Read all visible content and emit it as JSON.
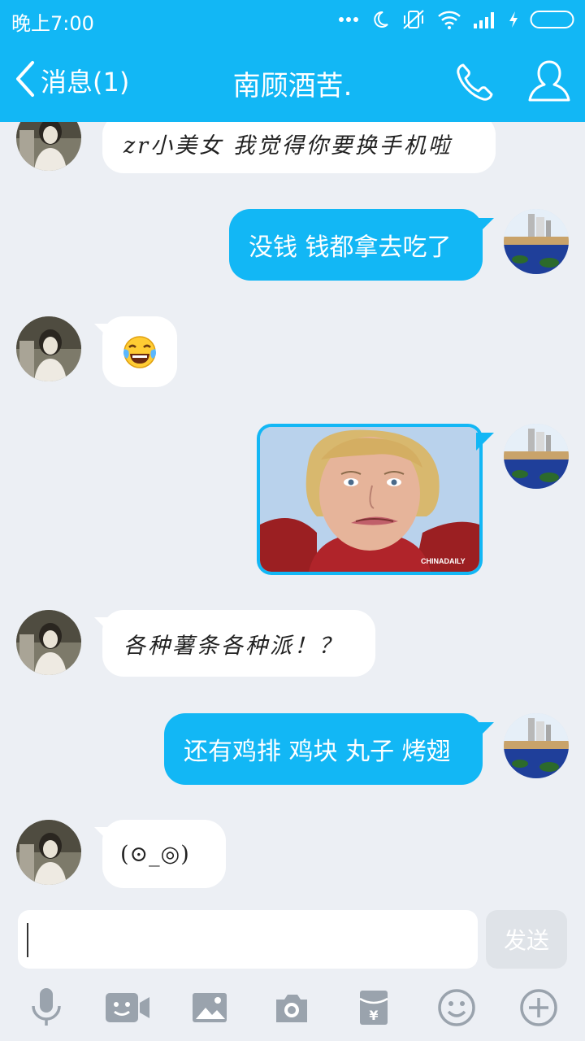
{
  "status_bar": {
    "time": "晚上7:00",
    "icons": [
      "more-dots-icon",
      "moon-icon",
      "vibrate-off-icon",
      "wifi-icon",
      "signal-icon",
      "charging-icon",
      "battery-icon"
    ]
  },
  "nav": {
    "back_label": "消息(1)",
    "title": "南顾酒苦.",
    "call_icon": "phone-icon",
    "profile_icon": "profile-icon"
  },
  "colors": {
    "accent": "#12b7f5",
    "background": "#eceff4",
    "incoming_bubble": "#ffffff",
    "outgoing_bubble": "#12b7f5"
  },
  "messages": [
    {
      "direction": "incoming",
      "text": "zr小美女  我觉得你要换手机啦"
    },
    {
      "direction": "outgoing",
      "text": "没钱 钱都拿去吃了"
    },
    {
      "direction": "incoming",
      "emoji": "😂",
      "emoji_name": "tears-of-joy-emoji"
    },
    {
      "direction": "outgoing",
      "image": "meme-photo",
      "image_caption": "CHINADAILY"
    },
    {
      "direction": "incoming",
      "text": "各种薯条各种派！？"
    },
    {
      "direction": "outgoing",
      "text": "还有鸡排 鸡块 丸子 烤翅"
    },
    {
      "direction": "incoming",
      "text": "(⊙_◎)"
    }
  ],
  "input": {
    "value": "",
    "send_label": "发送"
  },
  "toolbar": {
    "icons": [
      "microphone-icon",
      "video-call-icon",
      "picture-icon",
      "camera-icon",
      "red-packet-icon",
      "emoji-face-icon",
      "plus-icon"
    ]
  }
}
